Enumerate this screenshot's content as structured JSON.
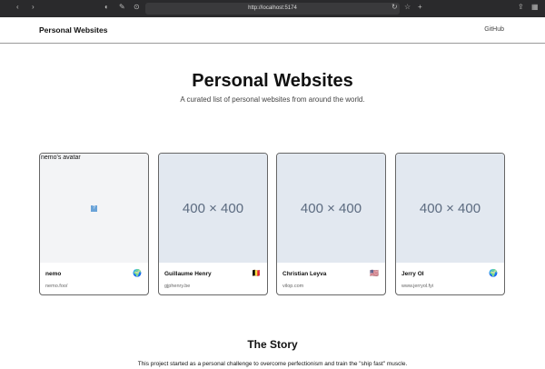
{
  "browser": {
    "url": "http://localhost:5174"
  },
  "nav": {
    "brand": "Personal Websites",
    "github": "GitHub"
  },
  "hero": {
    "title": "Personal Websites",
    "subtitle": "A curated list of personal websites from around the world."
  },
  "cards": [
    {
      "name": "nemo",
      "site": "nemo.foo/",
      "flag": "🌍",
      "alt": "nemo's avatar",
      "placeholder": "?"
    },
    {
      "name": "Guillaume Henry",
      "site": "gjphenry.be",
      "flag": "🇧🇪",
      "placeholder": "400 × 400"
    },
    {
      "name": "Christian Leyva",
      "site": "vilop.com",
      "flag": "🇺🇸",
      "placeholder": "400 × 400"
    },
    {
      "name": "Jerry OI",
      "site": "www.jerryol.fyi",
      "flag": "🌍",
      "placeholder": "400 × 400"
    }
  ],
  "story": {
    "title": "The Story",
    "text": "This project started as a personal challenge to overcome perfectionism and train the \"ship fast\" muscle."
  }
}
